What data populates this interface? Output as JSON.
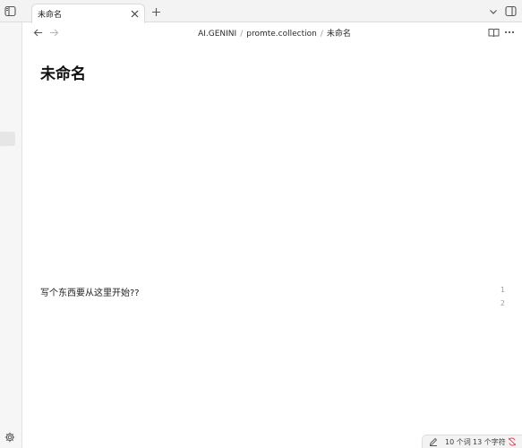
{
  "tab": {
    "title": "未命名"
  },
  "breadcrumb": {
    "vault": "AI.GENINI",
    "folder": "promte.collection",
    "note": "未命名",
    "separator": "/"
  },
  "note": {
    "title": "未命名",
    "line1": "写个东西要从这里开始??",
    "line_numbers": [
      "1",
      "2"
    ]
  },
  "status": {
    "words": "10 个词",
    "chars": "13 个字符"
  },
  "icons": {
    "sidebar": "sidebar-toggle-icon",
    "close": "close-icon",
    "new_tab": "plus-icon",
    "back": "arrow-left-icon",
    "forward": "arrow-right-icon",
    "reading": "book-open-icon",
    "more": "more-dots-icon",
    "tab_list": "chevron-down-icon",
    "right_sidebar": "right-sidebar-toggle-icon",
    "settings": "gear-icon",
    "edit": "pencil-icon",
    "sync": "sync-off-icon"
  },
  "colors": {
    "sync_error": "#e0506a",
    "text": "#1f1f1f",
    "muted": "#9f9f9f"
  }
}
